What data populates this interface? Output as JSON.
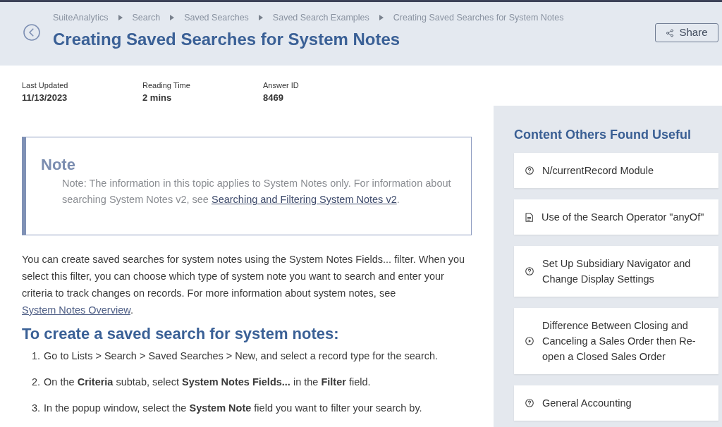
{
  "breadcrumb": [
    "SuiteAnalytics",
    "Search",
    "Saved Searches",
    "Saved Search Examples",
    "Creating Saved Searches for System Notes"
  ],
  "title": "Creating Saved Searches for System Notes",
  "share_button": "Share",
  "metadata": [
    {
      "label": "Last Updated",
      "value": "11/13/2023"
    },
    {
      "label": "Reading Time",
      "value": "2 mins"
    },
    {
      "label": "Answer ID",
      "value": "8469"
    }
  ],
  "note": {
    "title": "Note",
    "text": "Note: The information in this topic applies to System Notes only. For information about searching System Notes v2, see ",
    "link": "Searching and Filtering System Notes v2",
    "text_after": "."
  },
  "intro": {
    "text": "You can create saved searches for system notes using the System Notes Fields... filter. When you select this filter, you can choose which type of system note you want to search and enter your criteria to track changes on records. For more information about system notes, see ",
    "link": "System Notes Overview",
    "text_after": "."
  },
  "procedure": {
    "heading": "To create a saved search for system notes:",
    "steps": [
      {
        "number": "1.",
        "text": "Go to Lists > Search > Saved Searches > New, and select a record type for the search."
      },
      {
        "number": "2.",
        "text": "On the **Criteria** subtab, select **System Notes Fields...** in the **Filter** field."
      },
      {
        "number": "3.",
        "text": "In the popup window, select the **System Note** field you want to filter your search by."
      }
    ]
  },
  "sidebar": {
    "heading": "Content Others Found Useful",
    "items": [
      {
        "kind": "question",
        "title": "N/currentRecord Module"
      },
      {
        "kind": "document",
        "title": "Use of the Search Operator \"anyOf\""
      },
      {
        "kind": "question",
        "title": "Set Up Subsidiary Navigator and Change Display Settings"
      },
      {
        "kind": "video",
        "title": "Difference Between Closing and Canceling a Sales Order then Re-open a Closed Sales Order"
      },
      {
        "kind": "question",
        "title": "General Accounting"
      }
    ]
  }
}
